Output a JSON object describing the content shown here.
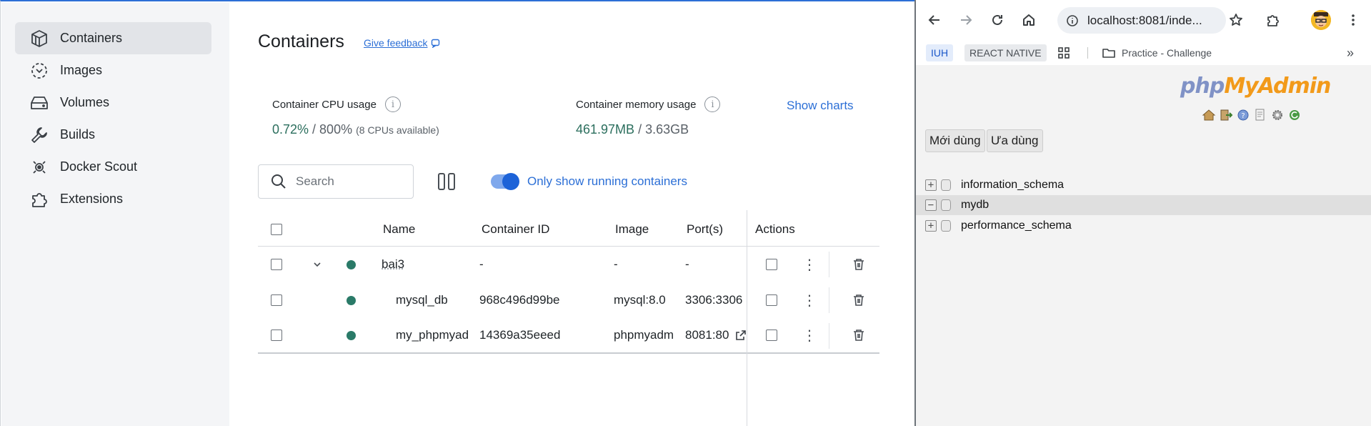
{
  "sidebar": {
    "items": [
      {
        "label": "Containers",
        "icon": "containers-icon",
        "active": true
      },
      {
        "label": "Images",
        "icon": "images-icon"
      },
      {
        "label": "Volumes",
        "icon": "volumes-icon"
      },
      {
        "label": "Builds",
        "icon": "builds-icon"
      },
      {
        "label": "Docker Scout",
        "icon": "docker-scout-icon"
      },
      {
        "label": "Extensions",
        "icon": "extensions-icon"
      }
    ]
  },
  "header": {
    "title": "Containers",
    "feedback": "Give feedback"
  },
  "stats": {
    "cpu_label": "Container CPU usage",
    "cpu_value": "0.72%",
    "cpu_total": " / 800%",
    "cpu_note": "(8 CPUs available)",
    "mem_label": "Container memory usage",
    "mem_value": "461.97MB",
    "mem_total": " / 3.63GB",
    "show_charts": "Show charts"
  },
  "toolbar": {
    "search_placeholder": "Search",
    "toggle_label": "Only show running containers",
    "toggle_on": true
  },
  "table": {
    "columns": [
      "Name",
      "Container ID",
      "Image",
      "Port(s)",
      "Actions"
    ],
    "rows": [
      {
        "name": "bai3",
        "id": "-",
        "image": "-",
        "ports": "-",
        "group": true
      },
      {
        "name": "mysql_db",
        "id": "968c496d99be",
        "image": "mysql:8.0",
        "ports": "3306:3306"
      },
      {
        "name": "my_phpmyad",
        "id": "14369a35eeed",
        "image": "phpmyadm",
        "ports": "8081:80"
      }
    ],
    "status_color": "#2a7a68"
  },
  "browser": {
    "url": "localhost:8081/inde...",
    "bookmarks": [
      "IUH",
      "REACT NATIVE",
      "Practice - Challenge"
    ]
  },
  "pma": {
    "logo_php": "php",
    "logo_my": "MyAdmin",
    "btn_recent": "Mới dùng",
    "btn_fav": "Ưa dùng",
    "databases": [
      {
        "name": "information_schema",
        "expanded": false
      },
      {
        "name": "mydb",
        "expanded": true
      },
      {
        "name": "performance_schema",
        "expanded": false
      }
    ]
  }
}
